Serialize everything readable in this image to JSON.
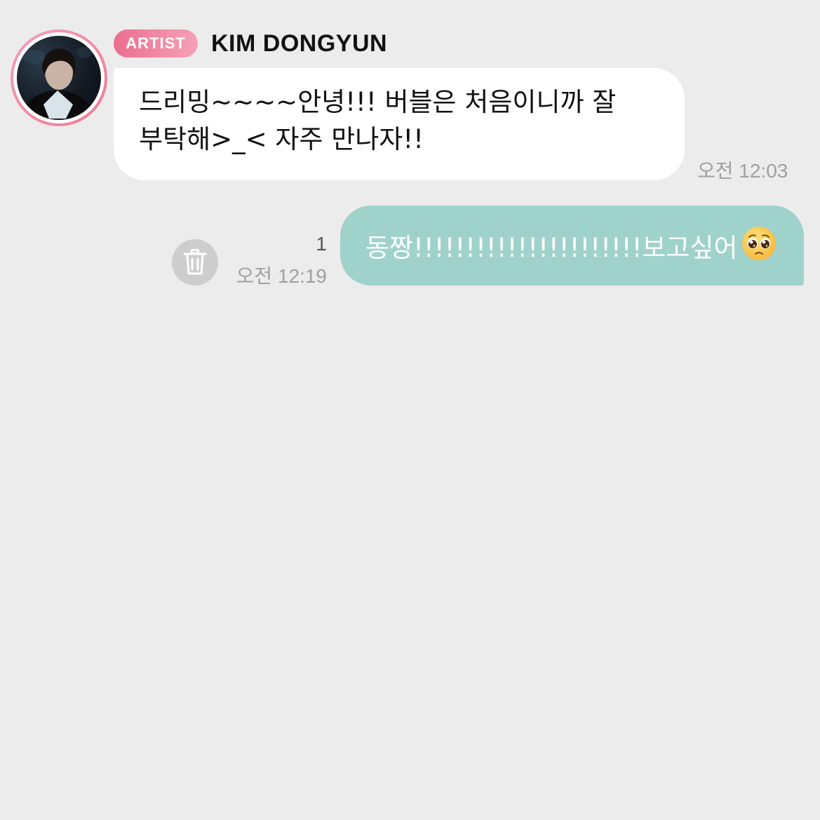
{
  "sender": {
    "badge": "ARTIST",
    "name": "KIM DONGYUN",
    "avatar_ring_color": "#ee7a98"
  },
  "messages": [
    {
      "direction": "incoming",
      "text": "드리밍~~~~안녕!!! 버블은 처음이니까 잘\n부탁해>_< 자주 만나자!!",
      "time": "오전 12:03"
    },
    {
      "direction": "outgoing",
      "text": "동짱!!!!!!!!!!!!!!!!!!!!!!보고싶어",
      "emoji": "pleading-face",
      "unread_count": "1",
      "time": "오전 12:19"
    }
  ],
  "actions": {
    "delete_icon": "trash-icon"
  },
  "colors": {
    "background": "#ececec",
    "incoming_bubble": "#ffffff",
    "outgoing_bubble": "#9fd2ca",
    "badge_gradient_start": "#ec6d8e",
    "badge_gradient_end": "#f5a2b8"
  }
}
